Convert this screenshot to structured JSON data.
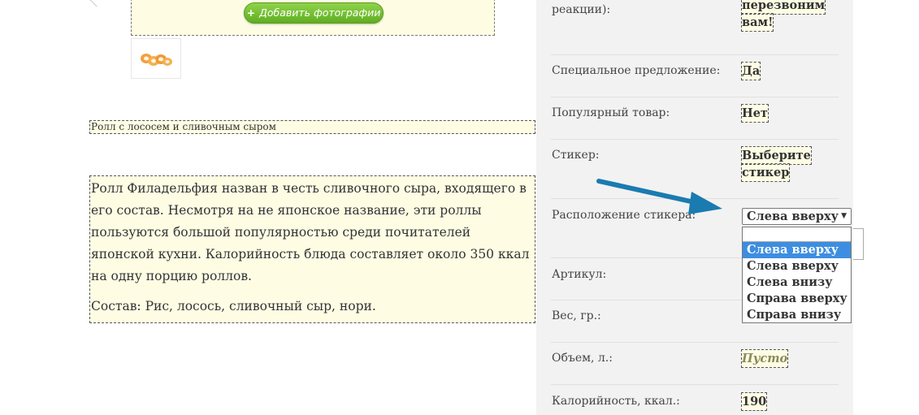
{
  "photos": {
    "add_button_label": "Добавить фотографии",
    "add_button_icon": "plus-icon"
  },
  "product": {
    "title": "Ролл с лососем и сливочным сыром",
    "description": [
      "Ролл Филадельфия назван в честь сливочного сыра, входящего в его состав. Несмотря на не японское название, эти роллы пользуются большой популярностью среди почитателей японской кухни. Калорийность блюда составляет около 350 ккал на одну порцию роллов.",
      "Состав: Рис, лосось, сливочный сыр, нори."
    ]
  },
  "properties": {
    "top_label_fragment": "реакции):",
    "top_value_line1": "перезвоним",
    "top_value_line2": "вам!",
    "special_offer": {
      "label": "Специальное предложение:",
      "value": "Да"
    },
    "popular": {
      "label": "Популярный товар:",
      "value": "Нет"
    },
    "sticker": {
      "label": "Стикер:",
      "value_line1": "Выберите",
      "value_line2": "стикер"
    },
    "sticker_position": {
      "label": "Расположение стикера:",
      "selected": "Слева вверху",
      "options": [
        "Слева вверху",
        "Слева вверху",
        "Слева внизу",
        "Справа вверху",
        "Справа внизу"
      ]
    },
    "article": {
      "label": "Артикул:"
    },
    "weight": {
      "label": "Вес, гр.:"
    },
    "volume": {
      "label": "Объем, л.:",
      "value": "Пусто"
    },
    "calories": {
      "label": "Калорийность, ккал.:",
      "value": "190"
    }
  },
  "colors": {
    "panel_bg": "#f2f2f2",
    "editable_bg": "#fefde4",
    "button_green": "#6cbf2c",
    "highlight_blue": "#3d8ee0",
    "arrow_blue": "#1a7bb0"
  }
}
